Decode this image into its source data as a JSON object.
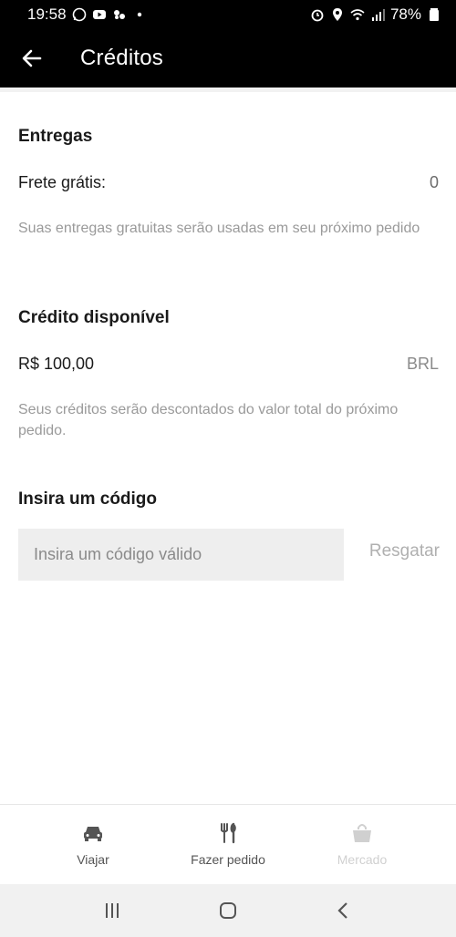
{
  "status": {
    "time": "19:58",
    "battery": "78%"
  },
  "header": {
    "title": "Créditos"
  },
  "deliveries": {
    "title": "Entregas",
    "free_shipping_label": "Frete grátis:",
    "free_shipping_value": "0",
    "note": "Suas entregas gratuitas serão usadas em seu próximo pedido"
  },
  "credit": {
    "title": "Crédito disponível",
    "amount": "R$ 100,00",
    "currency": "BRL",
    "note": "Seus créditos serão descontados do valor total do próximo pedido."
  },
  "code": {
    "title": "Insira um código",
    "placeholder": "Insira um código válido",
    "redeem_label": "Resgatar"
  },
  "bottom_nav": {
    "items": [
      {
        "label": "Viajar",
        "icon": "car-icon"
      },
      {
        "label": "Fazer pedido",
        "icon": "fork-knife-icon"
      },
      {
        "label": "Mercado",
        "icon": "shopping-bag-icon"
      }
    ]
  },
  "colors": {
    "header_bg": "#000000",
    "muted_text": "#9a9a9a",
    "input_bg": "#eeeeee"
  }
}
